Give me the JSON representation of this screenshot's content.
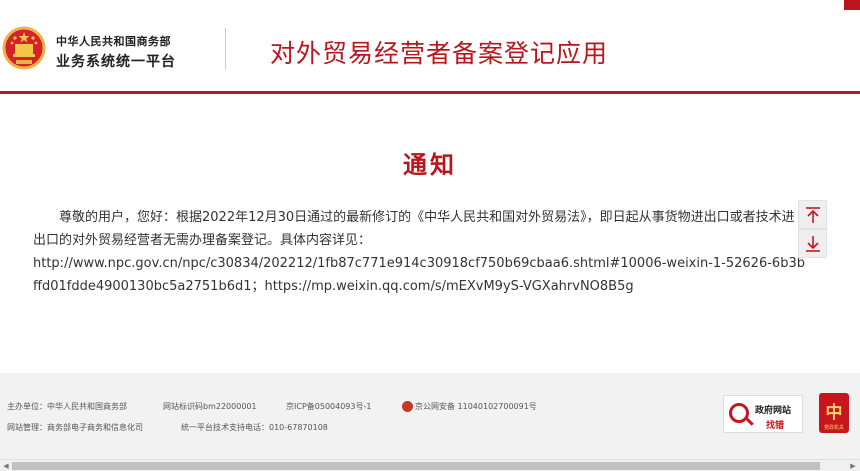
{
  "header": {
    "org_line1": "中华人民共和国商务部",
    "org_line2": "业务系统统一平台",
    "app_title": "对外贸易经营者备案登记应用"
  },
  "notice": {
    "title": "通知",
    "paragraph": "尊敬的用户，您好：根据2022年12月30日通过的最新修订的《中华人民共和国对外贸易法》，即日起从事货物进出口或者技术进出口的对外贸易经营者无需办理备案登记。具体内容详见：",
    "links": "http://www.npc.gov.cn/npc/c30834/202212/1fb87c771e914c30918cf750b69cbaa6.shtml#10006-weixin-1-52626-6b3bffd01fdde4900130bc5a2751b6d1；https://mp.weixin.qq.com/s/mEXvM9yS-VGXahrvNO8B5g"
  },
  "footer": {
    "sponsor": "主办单位：中华人民共和国商务部",
    "site_id": "网站标识码bm22000001",
    "icp": "京ICP备05004093号-1",
    "police": "京公网安备 11040102700091号",
    "manager": "网站管理：商务部电子商务和信息化司",
    "support": "统一平台技术支持电话：010-67870108",
    "gov_badge_line1": "政府网站",
    "gov_badge_line2": "找错",
    "party_badge_glyph": "中",
    "party_badge_caption": "党政机关"
  },
  "colors": {
    "brand_red": "#b8161c",
    "footer_bg": "#f2f2f2"
  },
  "icons": {
    "emblem": "national-emblem-icon",
    "scroll_up": "arrow-to-top-icon",
    "scroll_down": "arrow-to-bottom-icon",
    "police": "police-emblem-icon",
    "gov_badge": "magnifier-icon"
  }
}
